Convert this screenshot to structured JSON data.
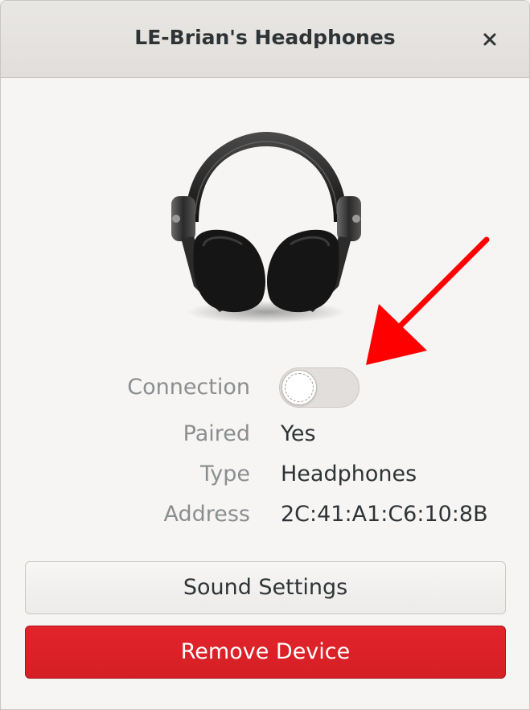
{
  "window": {
    "title": "LE-Brian's Headphones"
  },
  "device": {
    "icon": "headphones-image"
  },
  "properties": {
    "connection": {
      "label": "Connection",
      "enabled": false
    },
    "paired": {
      "label": "Paired",
      "value": "Yes"
    },
    "type": {
      "label": "Type",
      "value": "Headphones"
    },
    "address": {
      "label": "Address",
      "value": "2C:41:A1:C6:10:8B"
    }
  },
  "buttons": {
    "sound_settings": "Sound Settings",
    "remove_device": "Remove Device"
  },
  "colors": {
    "destructive": "#d41f25",
    "annotation_arrow": "#ff0000"
  }
}
